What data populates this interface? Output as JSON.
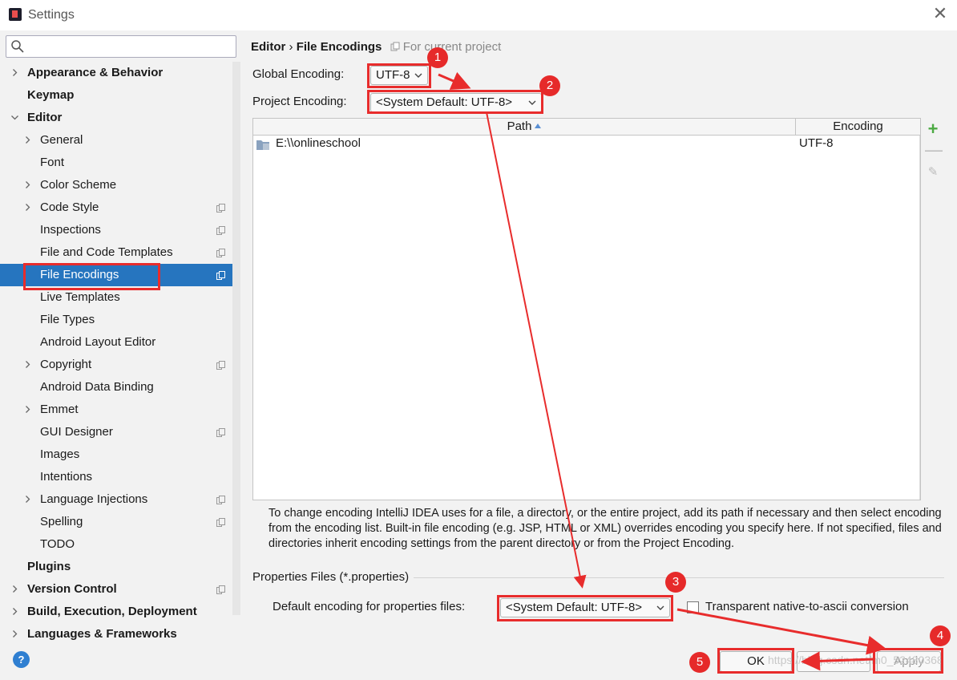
{
  "window": {
    "title": "Settings",
    "close_glyph": "✕"
  },
  "search": {
    "placeholder": ""
  },
  "tree": [
    {
      "label": "Appearance & Behavior",
      "bold": true,
      "expander": "collapsed",
      "indent": 0
    },
    {
      "label": "Keymap",
      "bold": true,
      "expander": "none",
      "indent": 0
    },
    {
      "label": "Editor",
      "bold": true,
      "expander": "expanded",
      "indent": 0
    },
    {
      "label": "General",
      "expander": "collapsed",
      "indent": 1
    },
    {
      "label": "Font",
      "expander": "none",
      "indent": 1
    },
    {
      "label": "Color Scheme",
      "expander": "collapsed",
      "indent": 1
    },
    {
      "label": "Code Style",
      "expander": "collapsed",
      "indent": 1,
      "project": true
    },
    {
      "label": "Inspections",
      "expander": "none",
      "indent": 1,
      "project": true
    },
    {
      "label": "File and Code Templates",
      "expander": "none",
      "indent": 1,
      "project": true
    },
    {
      "label": "File Encodings",
      "expander": "none",
      "indent": 1,
      "project": true,
      "selected": true
    },
    {
      "label": "Live Templates",
      "expander": "none",
      "indent": 1
    },
    {
      "label": "File Types",
      "expander": "none",
      "indent": 1
    },
    {
      "label": "Android Layout Editor",
      "expander": "none",
      "indent": 1
    },
    {
      "label": "Copyright",
      "expander": "collapsed",
      "indent": 1,
      "project": true
    },
    {
      "label": "Android Data Binding",
      "expander": "none",
      "indent": 1
    },
    {
      "label": "Emmet",
      "expander": "collapsed",
      "indent": 1
    },
    {
      "label": "GUI Designer",
      "expander": "none",
      "indent": 1,
      "project": true
    },
    {
      "label": "Images",
      "expander": "none",
      "indent": 1
    },
    {
      "label": "Intentions",
      "expander": "none",
      "indent": 1
    },
    {
      "label": "Language Injections",
      "expander": "collapsed",
      "indent": 1,
      "project": true
    },
    {
      "label": "Spelling",
      "expander": "none",
      "indent": 1,
      "project": true
    },
    {
      "label": "TODO",
      "expander": "none",
      "indent": 1
    },
    {
      "label": "Plugins",
      "bold": true,
      "expander": "none",
      "indent": 0
    },
    {
      "label": "Version Control",
      "bold": true,
      "expander": "collapsed",
      "indent": 0,
      "project": true
    },
    {
      "label": "Build, Execution, Deployment",
      "bold": true,
      "expander": "collapsed",
      "indent": 0
    },
    {
      "label": "Languages & Frameworks",
      "bold": true,
      "expander": "collapsed",
      "indent": 0
    }
  ],
  "breadcrumb": {
    "section": "Editor",
    "separator": "›",
    "page": "File Encodings",
    "scope": "For current project"
  },
  "global": {
    "label": "Global Encoding:",
    "value": "UTF-8"
  },
  "project": {
    "label": "Project Encoding:",
    "value": "<System Default: UTF-8>"
  },
  "table": {
    "columns": [
      "Path",
      "Encoding"
    ],
    "rows": [
      {
        "path": "E:\\\\onlineschool",
        "encoding": "UTF-8"
      }
    ]
  },
  "tools": {
    "add": "+",
    "remove": "—",
    "edit": "✎"
  },
  "description": "To change encoding IntelliJ IDEA uses for a file, a directory, or the entire project, add its path if necessary and then select encoding from the encoding list. Built-in file encoding (e.g. JSP, HTML or XML) overrides encoding you specify here. If not specified, files and directories inherit encoding settings from the parent directory or from the Project Encoding.",
  "properties": {
    "title": "Properties Files (*.properties)",
    "label": "Default encoding for properties files:",
    "value": "<System Default: UTF-8>",
    "ascii_label": "Transparent native-to-ascii conversion",
    "ascii_checked": false
  },
  "buttons": {
    "help": "?",
    "ok": "OK",
    "cancel": "",
    "apply": "Apply"
  },
  "watermark": "https://blog.csdn.net/m0_52480368",
  "annotations": [
    "1",
    "2",
    "3",
    "4",
    "5"
  ],
  "colors": {
    "selection": "#2675bf",
    "annotation": "#e82c2c",
    "add": "#4caa43"
  }
}
